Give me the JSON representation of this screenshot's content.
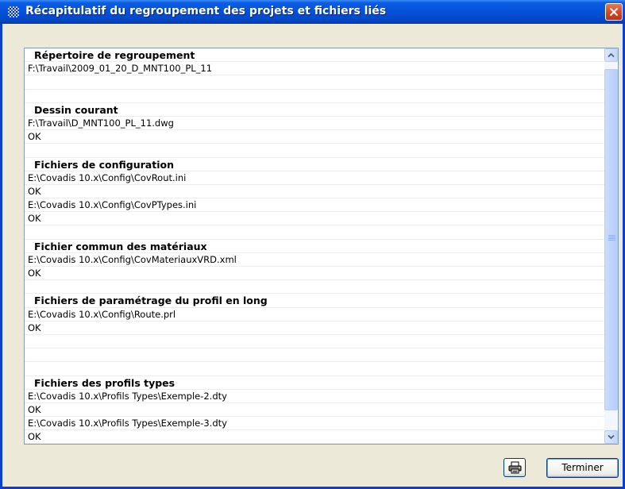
{
  "window": {
    "title": "Récapitulatif du regroupement des projets et fichiers liés",
    "title_icon": "grid-app-icon",
    "close_icon": "close-icon"
  },
  "list": {
    "rows": [
      {
        "type": "header",
        "text": "Répertoire de regroupement"
      },
      {
        "type": "item",
        "text": "F:\\Travail\\2009_01_20_D_MNT100_PL_11"
      },
      {
        "type": "empty",
        "text": ""
      },
      {
        "type": "empty",
        "text": ""
      },
      {
        "type": "header",
        "text": "Dessin courant"
      },
      {
        "type": "item",
        "text": "F:\\Travail\\D_MNT100_PL_11.dwg"
      },
      {
        "type": "item",
        "text": "OK"
      },
      {
        "type": "empty",
        "text": ""
      },
      {
        "type": "header",
        "text": "Fichiers de configuration"
      },
      {
        "type": "item",
        "text": "E:\\Covadis 10.x\\Config\\CovRout.ini"
      },
      {
        "type": "item",
        "text": "OK"
      },
      {
        "type": "item",
        "text": "E:\\Covadis 10.x\\Config\\CovPTypes.ini"
      },
      {
        "type": "item",
        "text": "OK"
      },
      {
        "type": "empty",
        "text": ""
      },
      {
        "type": "header",
        "text": "Fichier commun des matériaux"
      },
      {
        "type": "item",
        "text": "E:\\Covadis 10.x\\Config\\CovMateriauxVRD.xml"
      },
      {
        "type": "item",
        "text": "OK"
      },
      {
        "type": "empty",
        "text": ""
      },
      {
        "type": "header",
        "text": "Fichiers de paramétrage du profil en long"
      },
      {
        "type": "item",
        "text": "E:\\Covadis 10.x\\Config\\Route.prl"
      },
      {
        "type": "item",
        "text": "OK"
      },
      {
        "type": "empty",
        "text": ""
      },
      {
        "type": "empty",
        "text": ""
      },
      {
        "type": "empty",
        "text": ""
      },
      {
        "type": "header",
        "text": "Fichiers des profils types"
      },
      {
        "type": "item",
        "text": "E:\\Covadis 10.x\\Profils Types\\Exemple-2.dty"
      },
      {
        "type": "item",
        "text": "OK"
      },
      {
        "type": "item",
        "text": "E:\\Covadis 10.x\\Profils Types\\Exemple-3.dty"
      },
      {
        "type": "item",
        "text": "OK"
      }
    ]
  },
  "scrollbar": {
    "up_icon": "scroll-up-arrow-icon",
    "down_icon": "scroll-down-arrow-icon"
  },
  "buttons": {
    "print_icon": "printer-icon",
    "terminer_label": "Terminer"
  },
  "colors": {
    "titlebar": "#0552d8",
    "window_bg": "#ece9d8",
    "close_button": "#d2431e",
    "list_border": "#7f9db9"
  }
}
